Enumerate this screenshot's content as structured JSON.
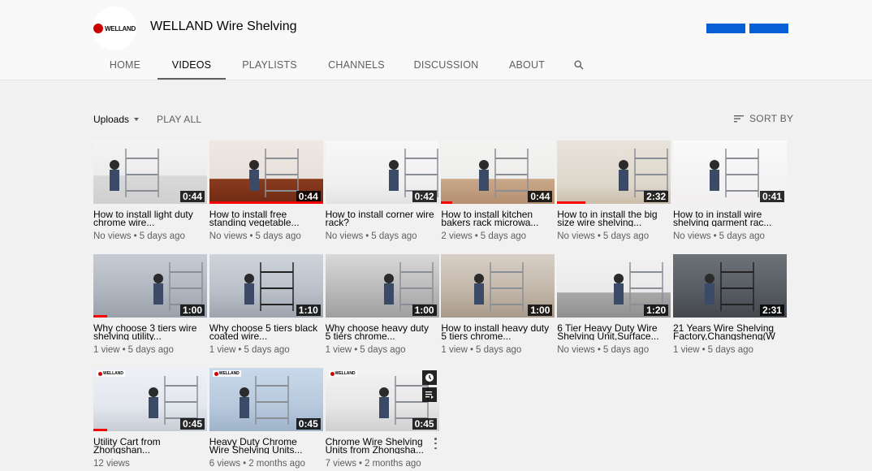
{
  "channel": {
    "name": "WELLAND Wire Shelving",
    "logo_text": "WELLAND",
    "header_buttons": [
      "",
      ""
    ]
  },
  "tabs": [
    {
      "label": "HOME",
      "active": false
    },
    {
      "label": "VIDEOS",
      "active": true
    },
    {
      "label": "PLAYLISTS",
      "active": false
    },
    {
      "label": "CHANNELS",
      "active": false
    },
    {
      "label": "DISCUSSION",
      "active": false
    },
    {
      "label": "ABOUT",
      "active": false
    }
  ],
  "toolbar": {
    "uploads_label": "Uploads",
    "play_all_label": "PLAY ALL",
    "sort_by_label": "SORT BY"
  },
  "videos": [
    {
      "title": "How to install light duty chrome wire...",
      "views": "No views",
      "age": "5 days ago",
      "duration": "0:44",
      "progress": 0.0
    },
    {
      "title": "How to install free standing vegetable...",
      "views": "No views",
      "age": "5 days ago",
      "duration": "0:44",
      "progress": 1.0
    },
    {
      "title": "How to install corner wire rack?",
      "views": "No views",
      "age": "5 days ago",
      "duration": "0:42",
      "progress": 0.0
    },
    {
      "title": "How to install kitchen bakers rack microwa...",
      "views": "2 views",
      "age": "5 days ago",
      "duration": "0:44",
      "progress": 0.1
    },
    {
      "title": "How to in install the big size wire shelving...",
      "views": "No views",
      "age": "5 days ago",
      "duration": "2:32",
      "progress": 0.25
    },
    {
      "title": "How to in install wire shelving garment rac...",
      "views": "No views",
      "age": "5 days ago",
      "duration": "0:41",
      "progress": 0.0
    },
    {
      "title": "Why choose 3 tiers wire shelving utility...",
      "views": "1 view",
      "age": "5 days ago",
      "duration": "1:00",
      "progress": 0.12
    },
    {
      "title": "Why choose 5 tiers black coated wire...",
      "views": "1 view",
      "age": "5 days ago",
      "duration": "1:10",
      "progress": 0.0
    },
    {
      "title": "Why choose heavy duty 5 tiers chrome...",
      "views": "1 view",
      "age": "5 days ago",
      "duration": "1:00",
      "progress": 0.0
    },
    {
      "title": "How to install heavy duty 5 tiers chrome...",
      "views": "1 view",
      "age": "5 days ago",
      "duration": "1:00",
      "progress": 0.0
    },
    {
      "title": "6 Tier Heavy Duty Wire Shelving Unit,Surface...",
      "views": "No views",
      "age": "5 days ago",
      "duration": "1:20",
      "progress": 0.0
    },
    {
      "title": "21 Years Wire Shelving Factory,Changsheng(W",
      "views": "1 view",
      "age": "5 days ago",
      "duration": "2:31",
      "progress": 0.0
    },
    {
      "title": "Utility Cart from Zhongshan...",
      "views": "12 views",
      "age": "",
      "duration": "0:45",
      "progress": 0.12
    },
    {
      "title": "Heavy Duty Chrome Wire Shelving Units...",
      "views": "6 views",
      "age": "2 months ago",
      "duration": "0:45",
      "progress": 0.0
    },
    {
      "title": "Chrome Wire Shelving Units from Zhongsha...",
      "views": "7 views",
      "age": "2 months ago",
      "duration": "0:45",
      "progress": 0.0,
      "hovered": true
    }
  ],
  "colors": {
    "accent": "#065fd4",
    "progress": "#ff0000",
    "brand_red": "#cc0000"
  }
}
